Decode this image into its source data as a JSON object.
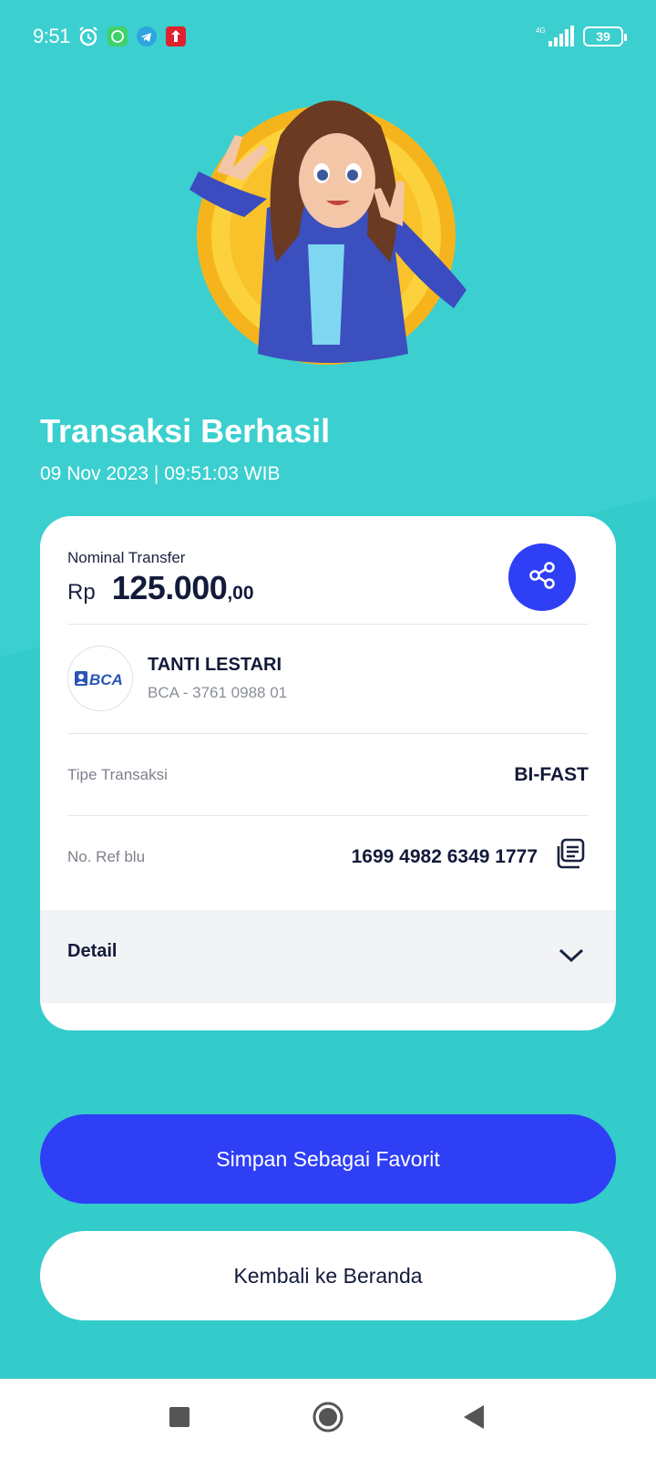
{
  "status_bar": {
    "time": "9:51",
    "battery": "39",
    "network": "4G"
  },
  "header": {
    "title": "Transaksi Berhasil",
    "datetime": "09 Nov 2023  |  09:51:03 WIB"
  },
  "card": {
    "nominal_label": "Nominal Transfer",
    "currency": "Rp",
    "amount": "125.000",
    "decimal": ",00",
    "recipient": {
      "bank_logo_text": "BCA",
      "name": "TANTI LESTARI",
      "account": "BCA - 3761 0988 01"
    },
    "type_label": "Tipe Transaksi",
    "type_value": "BI-FAST",
    "ref_label": "No. Ref blu",
    "ref_value": "1699 4982 6349 1777",
    "detail_label": "Detail"
  },
  "buttons": {
    "favorite_label": "Simpan Sebagai Favorit",
    "home_label": "Kembali ke Beranda"
  },
  "colors": {
    "background": "#3ccfcf",
    "primary": "#2e3ff5",
    "text_dark": "#131a3a"
  }
}
